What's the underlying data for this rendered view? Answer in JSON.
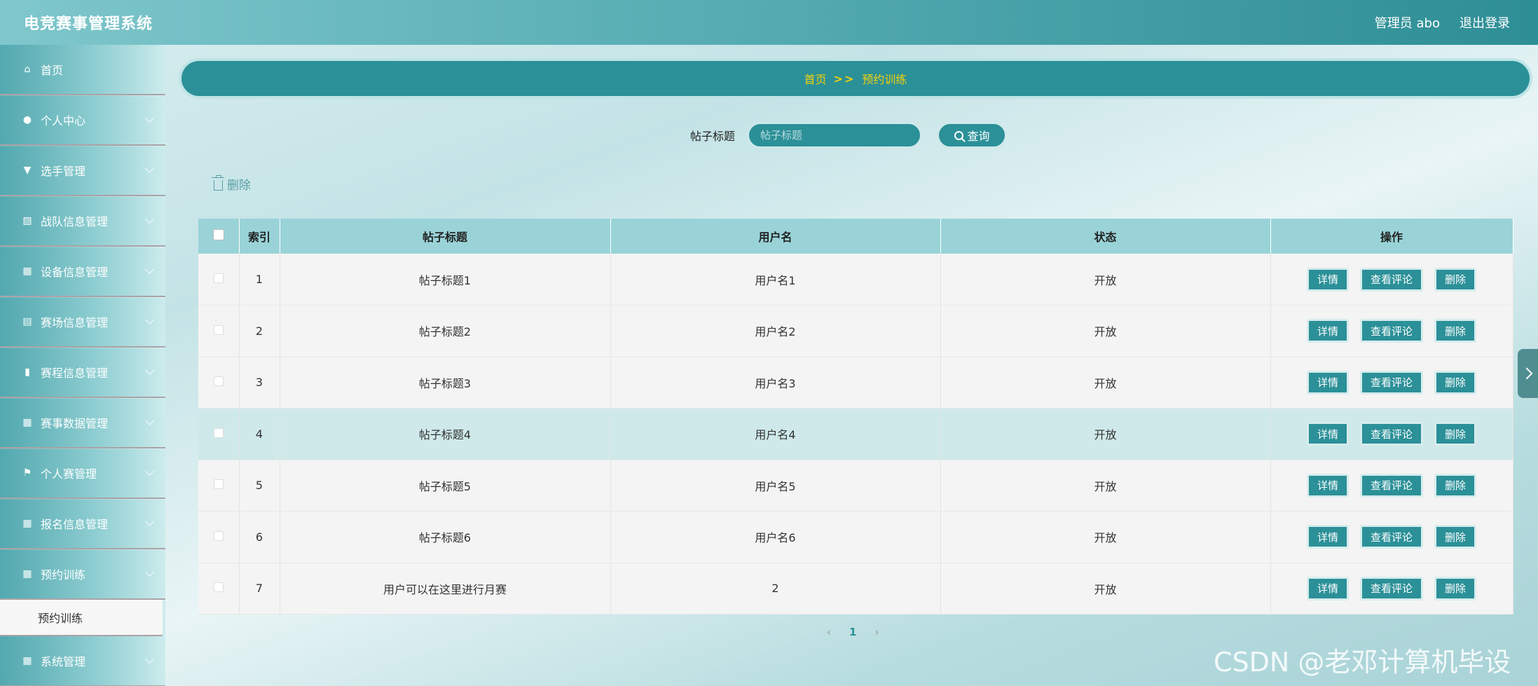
{
  "app": {
    "title": "电竞赛事管理系统"
  },
  "header": {
    "user": "管理员 abo",
    "logout": "退出登录"
  },
  "sidebar": {
    "items": [
      {
        "label": "首页",
        "icon": "home-icon"
      },
      {
        "label": "个人中心",
        "icon": "user-icon"
      },
      {
        "label": "选手管理",
        "icon": "player-icon"
      },
      {
        "label": "战队信息管理",
        "icon": "chart-icon"
      },
      {
        "label": "设备信息管理",
        "icon": "grid-icon"
      },
      {
        "label": "赛场信息管理",
        "icon": "clipboard-icon"
      },
      {
        "label": "赛程信息管理",
        "icon": "bar-icon"
      },
      {
        "label": "赛事数据管理",
        "icon": "grid-icon"
      },
      {
        "label": "个人赛管理",
        "icon": "flag-icon"
      },
      {
        "label": "报名信息管理",
        "icon": "grid-icon"
      },
      {
        "label": "预约训练",
        "icon": "grid-icon"
      },
      {
        "label": "系统管理",
        "icon": "grid-icon"
      }
    ],
    "sub_item": "预约训练"
  },
  "breadcrumb": {
    "home": "首页",
    "sep": ">>",
    "current": "预约训练"
  },
  "search": {
    "label": "帖子标题",
    "placeholder": "帖子标题",
    "button": "查询"
  },
  "actions": {
    "delete": "删除"
  },
  "table": {
    "headers": [
      "索引",
      "帖子标题",
      "用户名",
      "状态",
      "操作"
    ],
    "rows": [
      {
        "index": "1",
        "title": "帖子标题1",
        "user": "用户名1",
        "status": "开放"
      },
      {
        "index": "2",
        "title": "帖子标题2",
        "user": "用户名2",
        "status": "开放"
      },
      {
        "index": "3",
        "title": "帖子标题3",
        "user": "用户名3",
        "status": "开放"
      },
      {
        "index": "4",
        "title": "帖子标题4",
        "user": "用户名4",
        "status": "开放"
      },
      {
        "index": "5",
        "title": "帖子标题5",
        "user": "用户名5",
        "status": "开放"
      },
      {
        "index": "6",
        "title": "帖子标题6",
        "user": "用户名6",
        "status": "开放"
      },
      {
        "index": "7",
        "title": "用户可以在这里进行月赛",
        "user": "2",
        "status": "开放"
      }
    ],
    "op_labels": {
      "detail": "详情",
      "comments": "查看评论",
      "delete": "删除"
    }
  },
  "pagination": {
    "prev": "‹",
    "current": "1",
    "next": "›"
  },
  "watermark": "CSDN @老邓计算机毕设"
}
